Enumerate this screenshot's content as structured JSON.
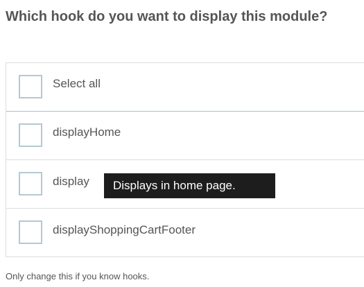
{
  "question": "Which hook do you want to display this module?",
  "select_all_label": "Select all",
  "hooks": [
    {
      "label": "displayHome"
    },
    {
      "label": "display"
    },
    {
      "label": "displayShoppingCartFooter"
    }
  ],
  "tooltip_text": "Displays in home page.",
  "help_text": "Only change this if you know hooks.",
  "colors": {
    "text": "#555555",
    "border": "#d9dde0",
    "checkbox_border": "#b4c8d2",
    "selected_divider": "#9fc0d8",
    "tooltip_bg": "#1d1d1d"
  }
}
